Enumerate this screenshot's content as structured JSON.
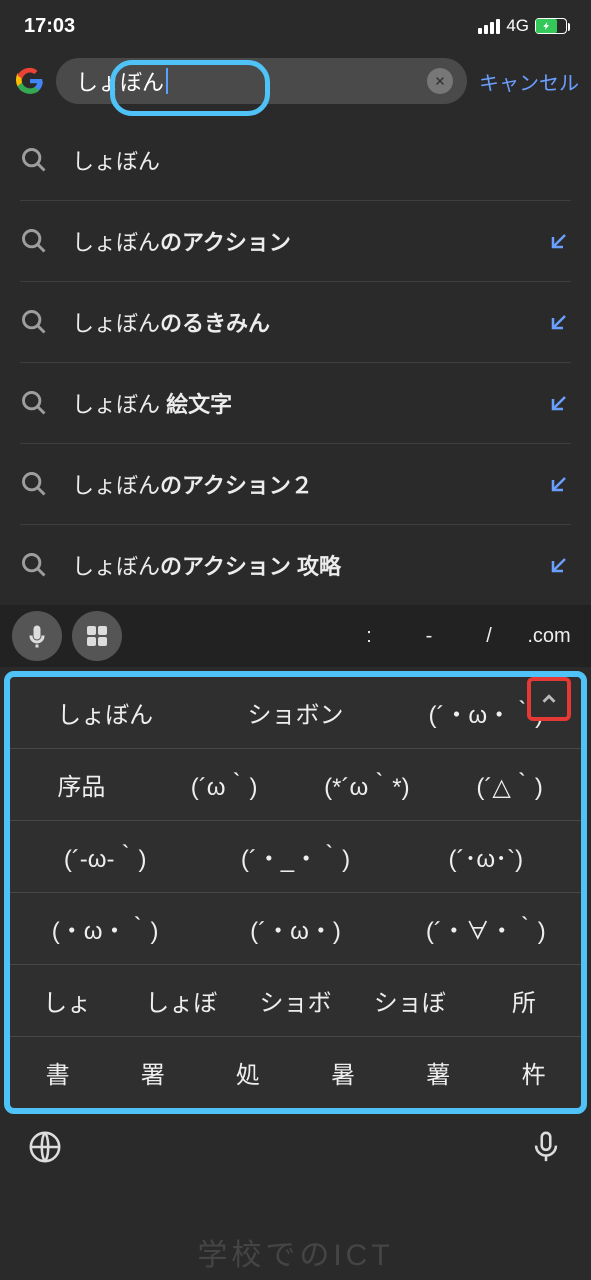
{
  "status": {
    "time": "17:03",
    "network": "4G"
  },
  "search": {
    "query": "しょぼん",
    "cancel_label": "キャンセル"
  },
  "suggestions": [
    {
      "prefix": "しょぼん",
      "suffix": "",
      "has_arrow": false
    },
    {
      "prefix": "しょぼん",
      "suffix": "のアクション",
      "has_arrow": true
    },
    {
      "prefix": "しょぼん",
      "suffix": "のるきみん",
      "has_arrow": true
    },
    {
      "prefix": "しょぼん ",
      "suffix": "絵文字",
      "has_arrow": true
    },
    {
      "prefix": "しょぼん",
      "suffix": "のアクション２",
      "has_arrow": true
    },
    {
      "prefix": "しょぼん",
      "suffix": "のアクション 攻略",
      "has_arrow": true
    }
  ],
  "toolbar_symbols": [
    ":",
    "-",
    "/",
    ".com"
  ],
  "candidate_rows": [
    [
      "しょぼん",
      "ショボン",
      "(´・ω・｀)"
    ],
    [
      "序品",
      "(´ω｀)",
      "(*´ω｀*)",
      "(´△｀)"
    ],
    [
      "(´-ω-｀)",
      "(´・_・｀)",
      "(´･ω･`)"
    ],
    [
      "(・ω・｀)",
      "(´・ω・)",
      "(´・∀・｀)"
    ],
    [
      "しょ",
      "しょぼ",
      "ショボ",
      "ショぼ",
      "所"
    ],
    [
      "書",
      "署",
      "処",
      "暑",
      "薯",
      "杵"
    ]
  ],
  "watermark": "学校でのICT"
}
